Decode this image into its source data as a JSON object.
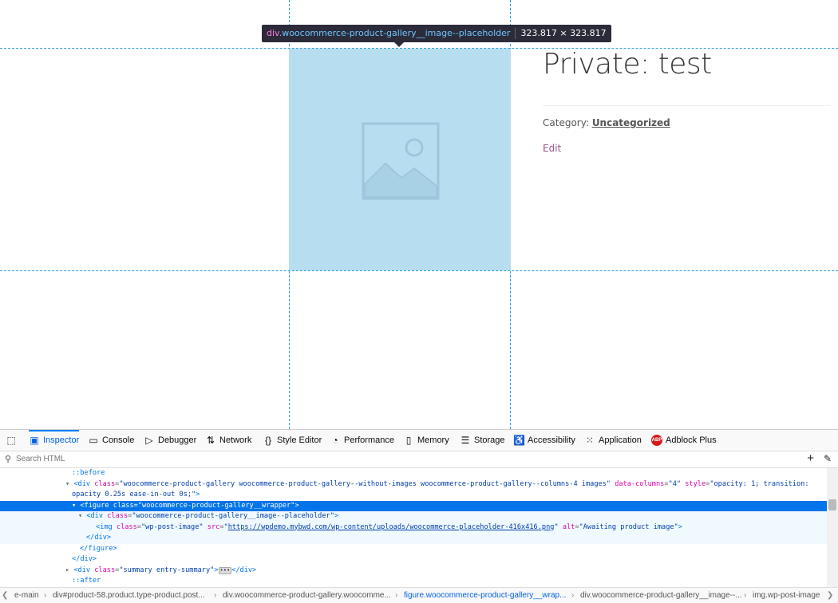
{
  "highlighter": {
    "tag": "div",
    "class_name": ".woocommerce-product-gallery__image--placeholder",
    "dimensions": "323.817 × 323.817"
  },
  "product": {
    "title": "Private: test",
    "category_label": "Category:",
    "category_value": "Uncategorized",
    "edit_label": "Edit"
  },
  "devtools": {
    "tabs": [
      {
        "label": "Inspector",
        "icon": "inspector-icon"
      },
      {
        "label": "Console",
        "icon": "console-icon"
      },
      {
        "label": "Debugger",
        "icon": "debugger-icon"
      },
      {
        "label": "Network",
        "icon": "network-icon"
      },
      {
        "label": "Style Editor",
        "icon": "style-editor-icon"
      },
      {
        "label": "Performance",
        "icon": "performance-icon"
      },
      {
        "label": "Memory",
        "icon": "memory-icon"
      },
      {
        "label": "Storage",
        "icon": "storage-icon"
      },
      {
        "label": "Accessibility",
        "icon": "accessibility-icon"
      },
      {
        "label": "Application",
        "icon": "application-icon"
      },
      {
        "label": "Adblock Plus",
        "icon": "adblock-plus-icon"
      }
    ],
    "search_placeholder": "Search HTML",
    "markup": {
      "before": "::before",
      "gallery_div_class": "woocommerce-product-gallery woocommerce-product-gallery--without-images woocommerce-product-gallery--columns-4 images",
      "gallery_data_columns": "4",
      "gallery_style_1": "opacity: 1; transition:",
      "gallery_style_2": "opacity 0.25s ease-in-out 0s;",
      "figure_class": "woocommerce-product-gallery__wrapper",
      "placeholder_class": "woocommerce-product-gallery__image--placeholder",
      "img_class": "wp-post-image",
      "img_src": "https://wpdemo.mybwd.com/wp-content/uploads/woocommerce-placeholder-416x416.png",
      "img_alt": "Awaiting product image",
      "close_div": "</div>",
      "close_figure": "</figure>",
      "summary_class": "summary entry-summary",
      "after": "::after"
    },
    "breadcrumbs": [
      "e-main",
      "div#product-58.product.type-product.post...",
      "div.woocommerce-product-gallery.woocomme...",
      "figure.woocommerce-product-gallery__wrap...",
      "div.woocommerce-product-gallery__image--...",
      "img.wp-post-image"
    ]
  },
  "colors": {
    "guide": "#2a9ad8",
    "placeholder_fill": "#b7def0",
    "selection": "#0074e8",
    "edit_link": "#96588a"
  }
}
